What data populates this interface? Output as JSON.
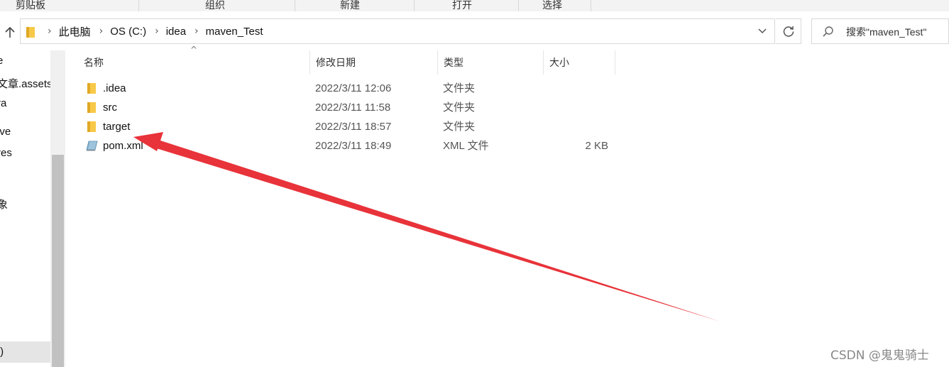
{
  "ribbon": {
    "groups": [
      "剪贴板",
      "组织",
      "新建",
      "打开",
      "选择"
    ]
  },
  "address_bar": {
    "breadcrumbs": [
      "此电脑",
      "OS (C:)",
      "idea",
      "maven_Test"
    ]
  },
  "search": {
    "placeholder": "搜索\"maven_Test\""
  },
  "nav_pane": {
    "items": [
      "e",
      "文章.assets",
      "ra",
      "ive",
      "res",
      "象",
      ":)"
    ]
  },
  "columns": {
    "name": "名称",
    "date": "修改日期",
    "type": "类型",
    "size": "大小"
  },
  "files": [
    {
      "name": ".idea",
      "date": "2022/3/11 12:06",
      "type": "文件夹",
      "size": "",
      "icon": "folder-icon"
    },
    {
      "name": "src",
      "date": "2022/3/11 11:58",
      "type": "文件夹",
      "size": "",
      "icon": "folder-icon"
    },
    {
      "name": "target",
      "date": "2022/3/11 18:57",
      "type": "文件夹",
      "size": "",
      "icon": "folder-icon"
    },
    {
      "name": "pom.xml",
      "date": "2022/3/11 18:49",
      "type": "XML 文件",
      "size": "2 KB",
      "icon": "xml-file-icon"
    }
  ],
  "colors": {
    "folder": "#f8c948",
    "folder_dark": "#e0a825",
    "annotation_arrow": "#e8333a"
  },
  "watermark": "CSDN @鬼鬼骑士"
}
